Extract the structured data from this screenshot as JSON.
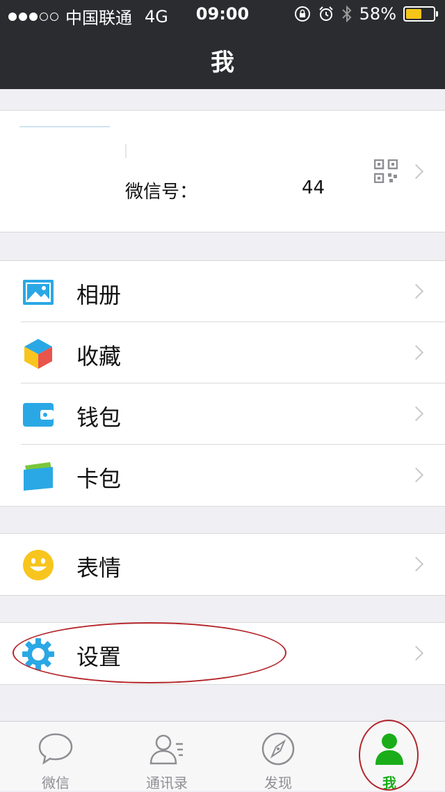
{
  "status_bar": {
    "carrier": "中国联通",
    "network": "4G",
    "time": "09:00",
    "battery": "58%",
    "battery_level": 0.58
  },
  "nav": {
    "title": "我"
  },
  "profile": {
    "wechat_id_label": "微信号：",
    "wechat_id_suffix": "44"
  },
  "menu_groups": [
    {
      "items": [
        {
          "label": "相册",
          "icon": "album-icon"
        },
        {
          "label": "收藏",
          "icon": "favorites-icon"
        },
        {
          "label": "钱包",
          "icon": "wallet-icon"
        },
        {
          "label": "卡包",
          "icon": "card-package-icon"
        }
      ]
    },
    {
      "items": [
        {
          "label": "表情",
          "icon": "sticker-icon"
        }
      ]
    },
    {
      "items": [
        {
          "label": "设置",
          "icon": "settings-gear-icon"
        }
      ]
    }
  ],
  "tabbar": {
    "tabs": [
      {
        "label": "微信",
        "icon": "chat-bubble-icon"
      },
      {
        "label": "通讯录",
        "icon": "contacts-icon"
      },
      {
        "label": "发现",
        "icon": "compass-icon"
      },
      {
        "label": "我",
        "icon": "me-person-icon",
        "active": true
      }
    ]
  },
  "colors": {
    "active_green": "#1aad19",
    "nav_bg": "#2b2c30",
    "annotation_red": "#b3262b"
  }
}
